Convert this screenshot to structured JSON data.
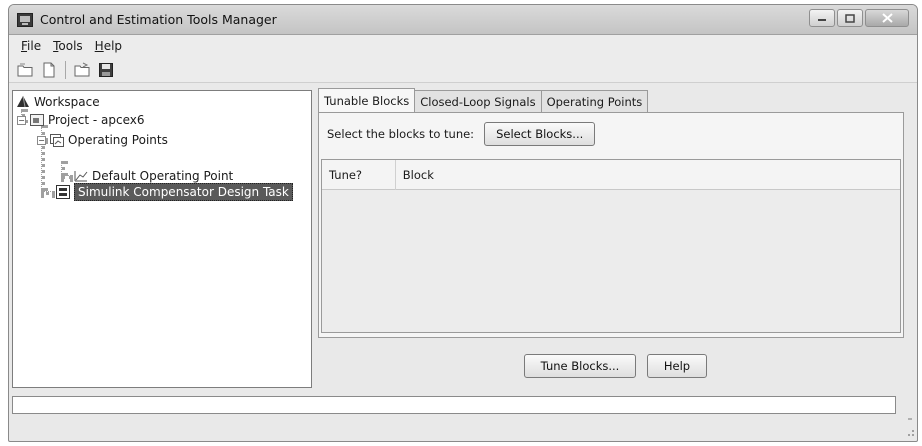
{
  "window": {
    "title": "Control and Estimation Tools Manager"
  },
  "menu": [
    {
      "key": "F",
      "rest": "ile"
    },
    {
      "key": "T",
      "rest": "ools"
    },
    {
      "key": "H",
      "rest": "elp"
    }
  ],
  "toolbar": {
    "icons": [
      "new-project-icon",
      "new-task-icon",
      "open-icon",
      "save-icon"
    ]
  },
  "tree": {
    "workspace": "Workspace",
    "project": "Project - apcex6",
    "operating_points": "Operating Points",
    "default_op": "Default Operating Point",
    "task": "Simulink Compensator Design Task"
  },
  "tabs": [
    "Tunable Blocks",
    "Closed-Loop Signals",
    "Operating Points"
  ],
  "tunable": {
    "select_label": "Select the blocks to tune:",
    "select_button": "Select Blocks...",
    "columns": [
      "Tune?",
      "Block"
    ]
  },
  "buttons": {
    "tune": "Tune Blocks...",
    "help": "Help"
  }
}
